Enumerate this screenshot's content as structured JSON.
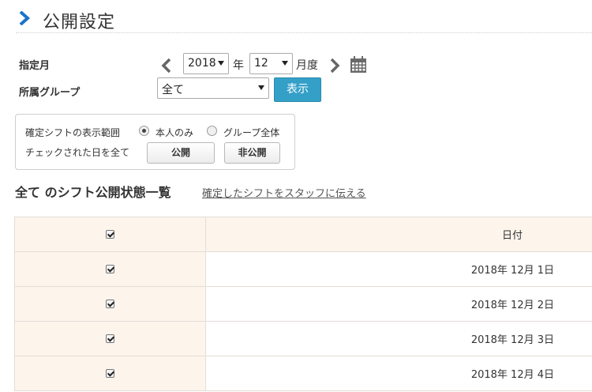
{
  "header": {
    "title": "公開設定"
  },
  "filters": {
    "month_label": "指定月",
    "year_value": "2018",
    "year_unit": "年",
    "month_value": "12",
    "month_unit": "月度",
    "group_label": "所属グループ",
    "group_value": "全て",
    "show_button": "表示"
  },
  "range_box": {
    "label": "確定シフトの表示範囲",
    "option_self": "本人のみ",
    "option_group": "グループ全体",
    "selected": "本人のみ",
    "check_label": "チェックされた日を全て",
    "public_button": "公開",
    "private_button": "非公開"
  },
  "list": {
    "title": "全て のシフト公開状態一覧",
    "notify_link": "確定したシフトをスタッフに伝える",
    "column_header": "日付",
    "header_checked": true,
    "rows": [
      {
        "date": "2018年 12月 1日",
        "checked": true
      },
      {
        "date": "2018年 12月 2日",
        "checked": true
      },
      {
        "date": "2018年 12月 3日",
        "checked": true
      },
      {
        "date": "2018年 12月 4日",
        "checked": true
      }
    ]
  },
  "colors": {
    "accent": "#1a73c8",
    "show_button": "#34a0c8",
    "table_tint": "#fdf4ec"
  },
  "icons": [
    "chevron-right-icon",
    "chevron-left-icon",
    "calendar-icon"
  ]
}
